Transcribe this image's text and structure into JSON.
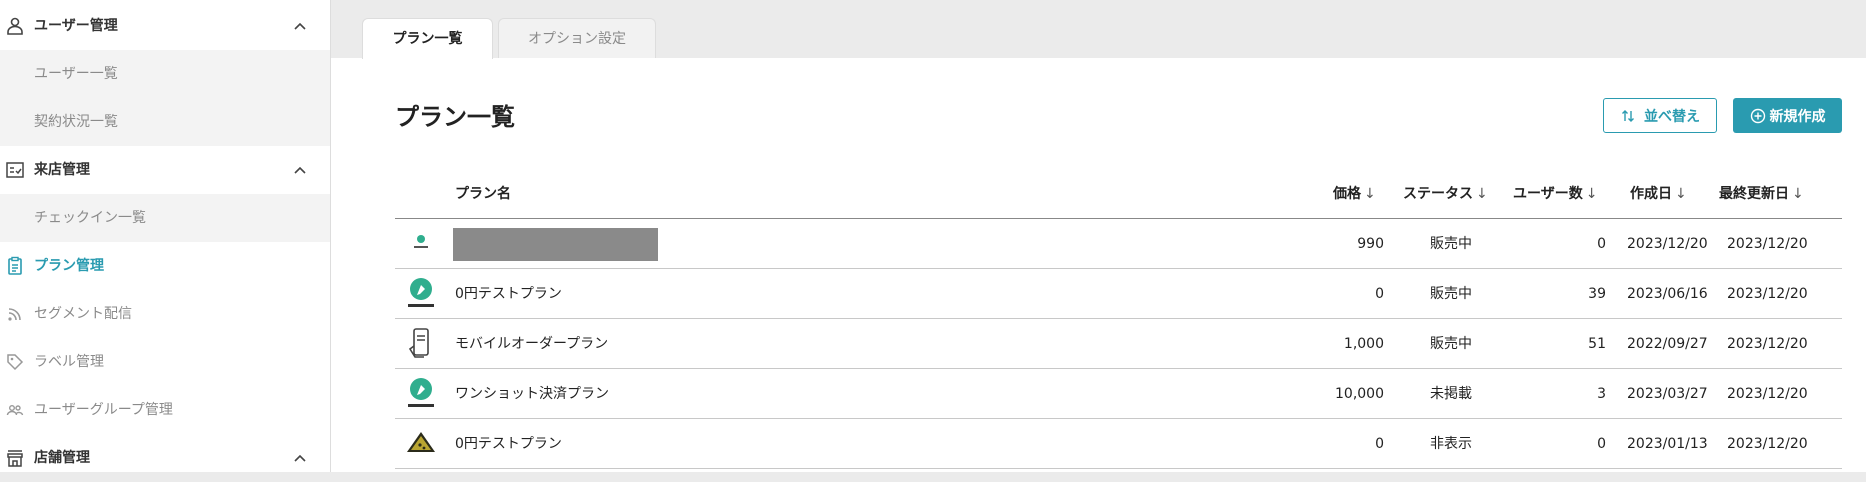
{
  "sidebar": {
    "items": [
      {
        "label": "ユーザー管理",
        "icon": "person-icon",
        "kind": "section"
      },
      {
        "label": "ユーザー一覧",
        "kind": "sub"
      },
      {
        "label": "契約状況一覧",
        "kind": "sub"
      },
      {
        "label": "来店管理",
        "icon": "checklist-icon",
        "kind": "section"
      },
      {
        "label": "チェックイン一覧",
        "kind": "sub"
      },
      {
        "label": "プラン管理",
        "icon": "clipboard-icon",
        "kind": "active"
      },
      {
        "label": "セグメント配信",
        "icon": "rss-icon",
        "kind": "item"
      },
      {
        "label": "ラベル管理",
        "icon": "tag-icon",
        "kind": "item"
      },
      {
        "label": "ユーザーグループ管理",
        "icon": "group-icon",
        "kind": "item"
      },
      {
        "label": "店舗管理",
        "icon": "store-icon",
        "kind": "section"
      }
    ]
  },
  "tabs": [
    {
      "label": "プラン一覧",
      "active": true
    },
    {
      "label": "オプション設定",
      "active": false
    }
  ],
  "main": {
    "title": "プラン一覧",
    "sort_button": "並べ替え",
    "create_button": "新規作成"
  },
  "table": {
    "headers": {
      "name": "プラン名",
      "price": "価格",
      "status": "ステータス",
      "users": "ユーザー数",
      "created": "作成日",
      "updated": "最終更新日"
    },
    "sort_arrow": "↓",
    "rows": [
      {
        "name": "",
        "price": "990",
        "status": "販売中",
        "users": "0",
        "created": "2023/12/20",
        "updated": "2023/12/20",
        "thumb": "small-green-logo",
        "redacted": true
      },
      {
        "name": "0円テストプラン",
        "price": "0",
        "status": "販売中",
        "users": "39",
        "created": "2023/06/16",
        "updated": "2023/12/20",
        "thumb": "green-logo"
      },
      {
        "name": "モバイルオーダープラン",
        "price": "1,000",
        "status": "販売中",
        "users": "51",
        "created": "2022/09/27",
        "updated": "2023/12/20",
        "thumb": "phone-hand-icon"
      },
      {
        "name": "ワンショット決済プラン",
        "price": "10,000",
        "status": "未掲載",
        "users": "3",
        "created": "2023/03/27",
        "updated": "2023/12/20",
        "thumb": "green-logo"
      },
      {
        "name": "0円テストプラン",
        "price": "0",
        "status": "非表示",
        "users": "0",
        "created": "2023/01/13",
        "updated": "2023/12/20",
        "thumb": "pizza-icon"
      }
    ]
  },
  "colors": {
    "accent": "#2a9bb0",
    "muted": "#8a8a8a",
    "sub_bg": "#f3f3f3"
  }
}
